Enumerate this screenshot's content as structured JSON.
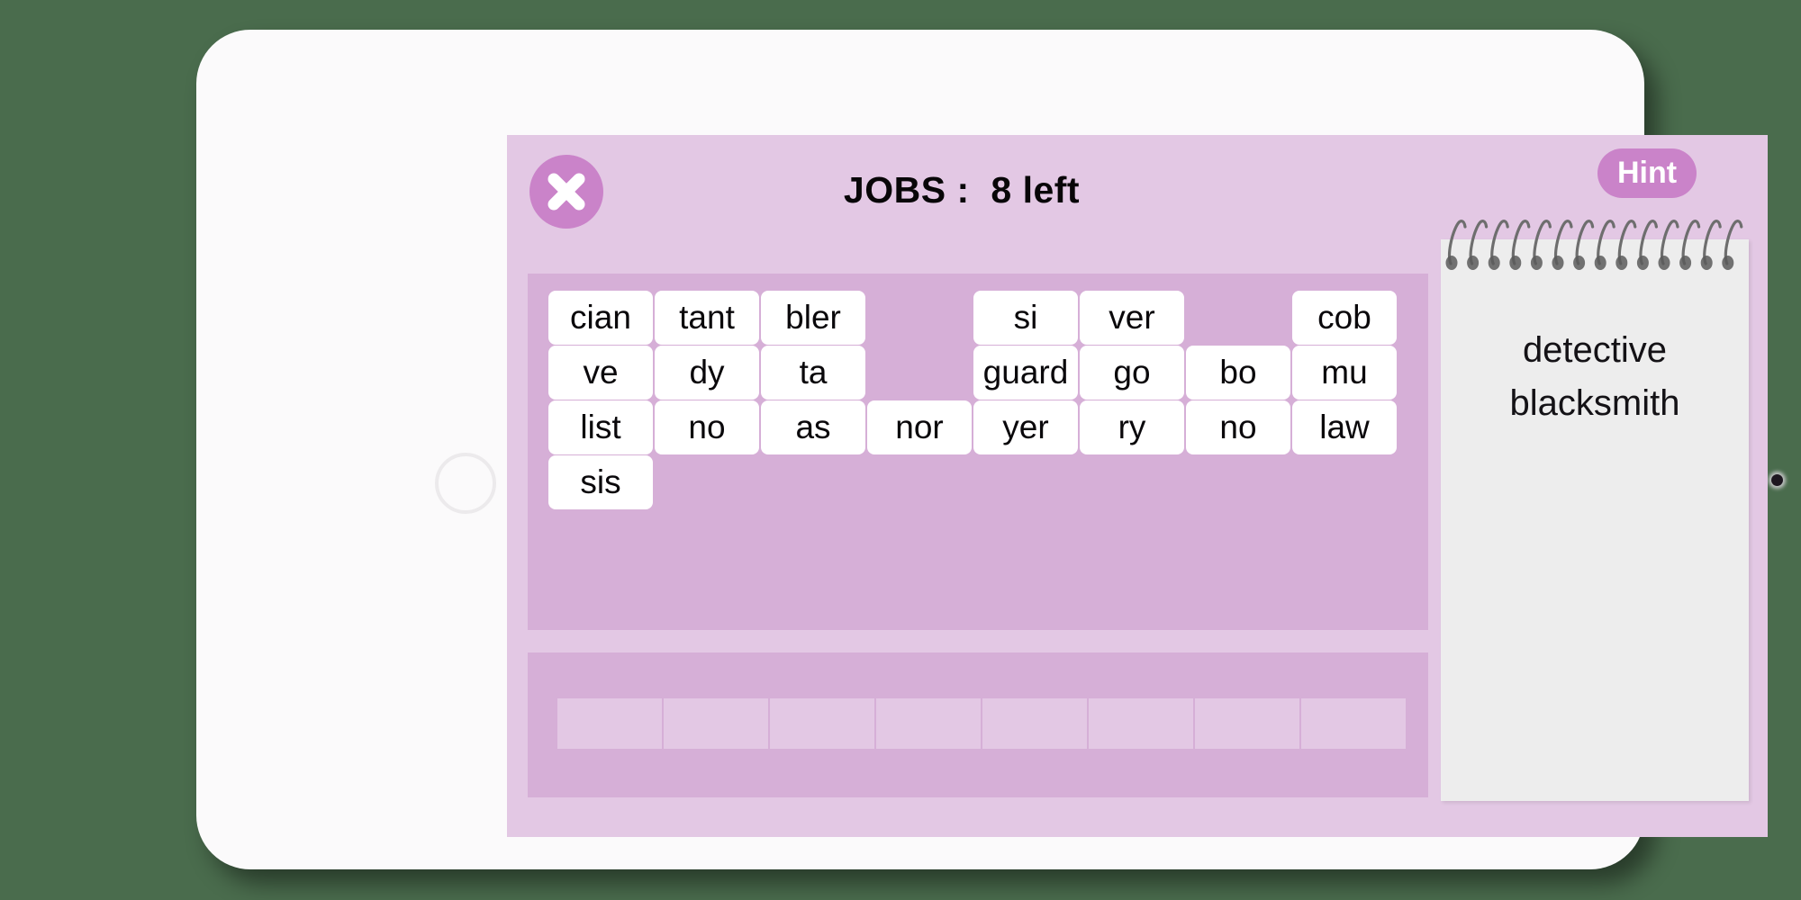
{
  "app": {
    "background_color": "#4a6c4d",
    "device": "tablet",
    "bezel_color": "#fbfafb"
  },
  "game": {
    "screen_background": "#e3c8e4",
    "panel_color": "#d6afd7",
    "accent_color": "#ca83c9",
    "tile_color": "#ffffff",
    "header": {
      "title": "JOBS :  8 left",
      "category": "JOBS",
      "remaining": "8 left",
      "close_label": "close-icon",
      "hint_label": "Hint"
    },
    "tiles": {
      "columns": 8,
      "rows": 4,
      "grid": [
        [
          "cian",
          "tant",
          "bler",
          "",
          "si",
          "ver",
          "",
          "cob"
        ],
        [
          "ve",
          "dy",
          "ta",
          "",
          "guard",
          "go",
          "bo",
          "mu"
        ],
        [
          "list",
          "no",
          "as",
          "nor",
          "yer",
          "ry",
          "no",
          "law"
        ],
        [
          "sis",
          "",
          "",
          "",
          "",
          "",
          "",
          ""
        ]
      ]
    },
    "answer_slots": {
      "count": 8,
      "values": [
        "",
        "",
        "",
        "",
        "",
        "",
        "",
        ""
      ]
    },
    "notepad": {
      "words": [
        "detective",
        "blacksmith"
      ],
      "paper_color": "#ededed",
      "spiral_rings": 14
    }
  }
}
